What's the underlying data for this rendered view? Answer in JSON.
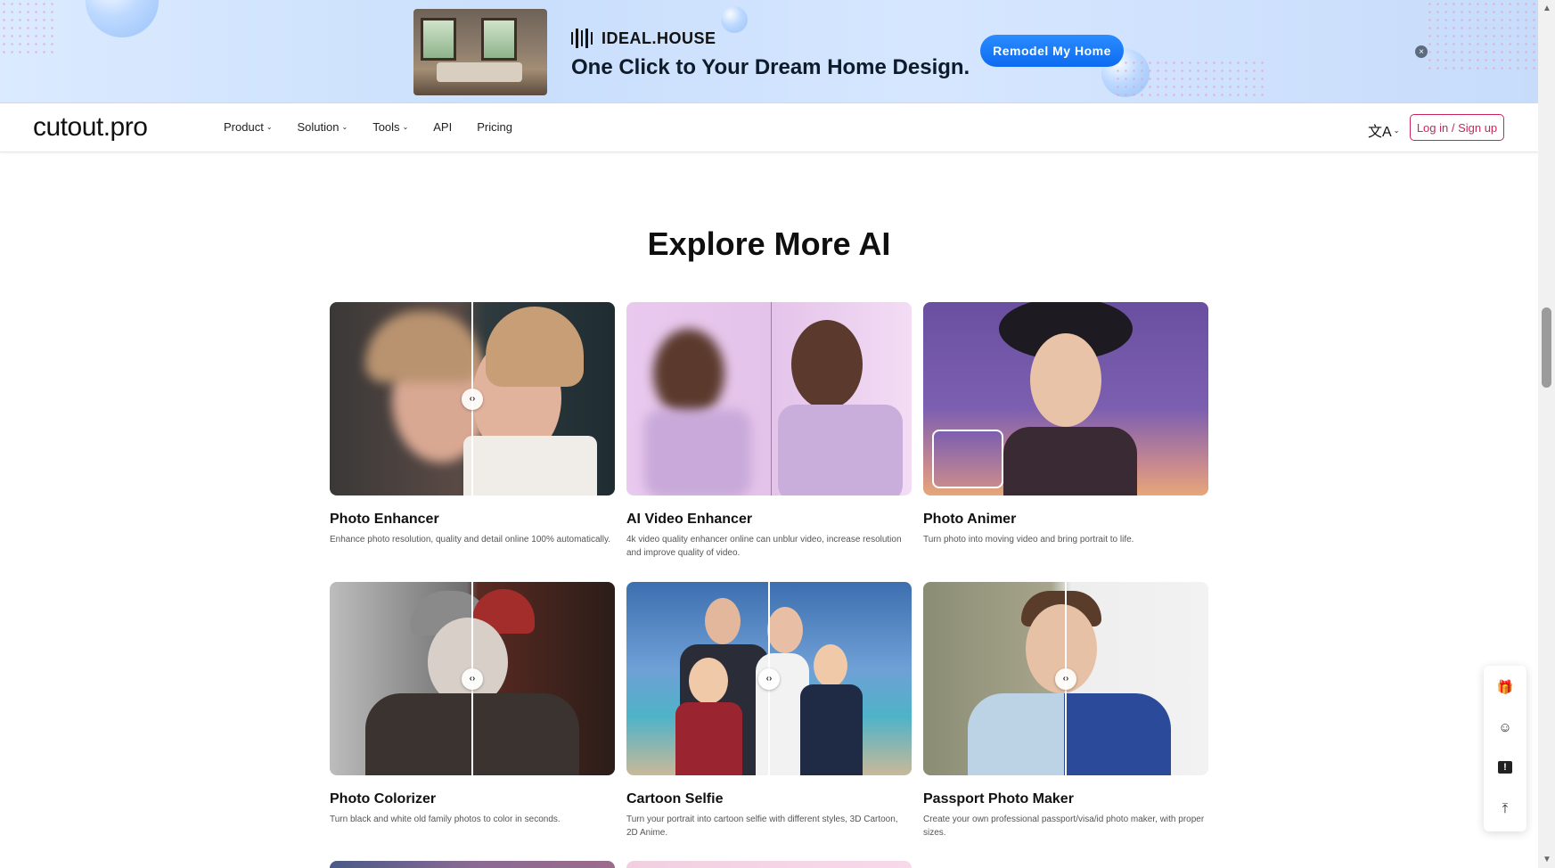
{
  "ad": {
    "brand": "IDEAL.HOUSE",
    "headline": "One Click to Your Dream Home Design.",
    "cta": "Remodel My Home",
    "close": "×"
  },
  "nav": {
    "logo": "cutout.pro",
    "menu": [
      {
        "label": "Product",
        "dropdown": true
      },
      {
        "label": "Solution",
        "dropdown": true
      },
      {
        "label": "Tools",
        "dropdown": true
      },
      {
        "label": "API",
        "dropdown": false
      },
      {
        "label": "Pricing",
        "dropdown": false
      }
    ],
    "language_icon": "translate-icon",
    "login": "Log in / Sign up"
  },
  "section": {
    "title": "Explore More AI"
  },
  "cards": [
    {
      "name": "Photo Enhancer",
      "desc": "Enhance photo resolution, quality and detail online 100% automatically."
    },
    {
      "name": "AI Video Enhancer",
      "desc": "4k video quality enhancer online can unblur video, increase resolution and improve quality of video."
    },
    {
      "name": "Photo Animer",
      "desc": "Turn photo into moving video and bring portrait to life."
    },
    {
      "name": "Photo Colorizer",
      "desc": "Turn black and white old family photos to color in seconds."
    },
    {
      "name": "Cartoon Selfie",
      "desc": "Turn your portrait into cartoon selfie with different styles, 3D Cartoon, 2D Anime."
    },
    {
      "name": "Passport Photo Maker",
      "desc": "Create your own professional passport/visa/id photo maker, with proper sizes."
    }
  ],
  "compare_handle": "‹›",
  "floating_tools": [
    "gift-icon",
    "support-icon",
    "feedback-icon",
    "back-to-top-icon"
  ],
  "colors": {
    "accent": "#c9255b",
    "ad_cta": "#0c6bf0"
  }
}
